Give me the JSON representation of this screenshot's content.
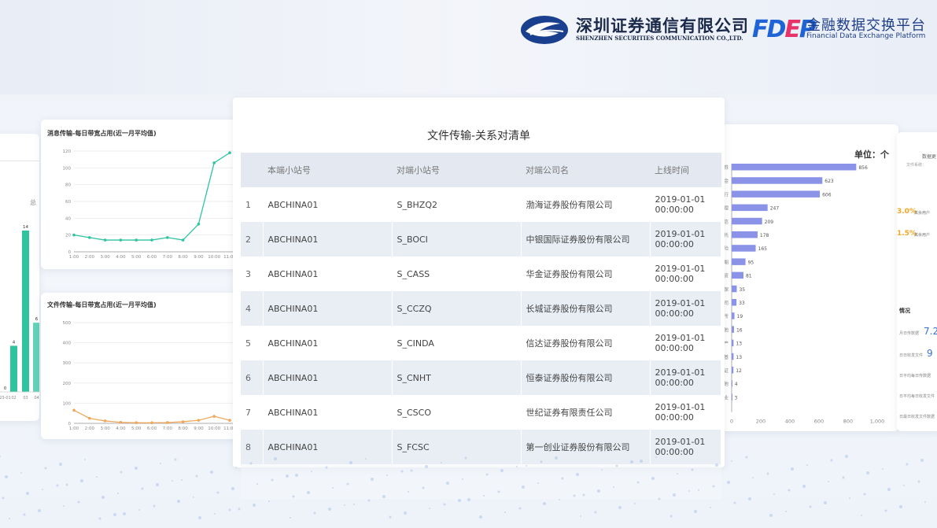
{
  "brand": {
    "company_cn": "深圳证券通信有限公司",
    "company_en": "SHENZHEN SECURITIES COMMUNICATION CO.,LTD.",
    "fdep": "FDEP",
    "platform_cn": "金融数据交换平台",
    "platform_en": "Financial Data Exchange Platform"
  },
  "colors": {
    "teal": "#2ec4a0",
    "orange": "#f0a75a",
    "bar_blue": "#8a93e8",
    "brand_blue": "#1e64d7",
    "brand_pink": "#e8336a"
  },
  "left_card": {
    "side_text": "总",
    "chart_data": {
      "type": "bar",
      "categories": [
        "23-01",
        "02",
        "03",
        "04"
      ],
      "values": [
        0,
        4,
        14,
        6
      ],
      "color": "#2ec4a0"
    }
  },
  "msg_chart": {
    "title": "消息传输-每日带宽占用(近一月平均值)",
    "chart_data": {
      "type": "line",
      "x": [
        "1:00",
        "2:00",
        "3:00",
        "4:00",
        "5:00",
        "6:00",
        "7:00",
        "8:00",
        "9:00",
        "10:00",
        "11:00"
      ],
      "values": [
        20,
        17,
        14,
        14,
        14,
        14,
        17,
        14,
        33,
        106,
        118
      ],
      "ylim": [
        0,
        120
      ],
      "yticks": [
        0,
        20,
        40,
        60,
        80,
        100,
        120
      ],
      "color": "#2ec4a0"
    }
  },
  "file_chart": {
    "title": "文件传输-每日带宽占用(近一月平均值)",
    "chart_data": {
      "type": "line",
      "x": [
        "1:00",
        "2:00",
        "3:00",
        "4:00",
        "5:00",
        "6:00",
        "7:00",
        "8:00",
        "9:00",
        "10:00",
        "11:00"
      ],
      "values": [
        65,
        25,
        12,
        5,
        3,
        3,
        4,
        8,
        15,
        35,
        15
      ],
      "ylim": [
        0,
        500
      ],
      "yticks": [
        0,
        100,
        200,
        300,
        400,
        500
      ],
      "color": "#f0a75a"
    }
  },
  "relation_table": {
    "title": "文件传输-关系对清单",
    "columns": [
      "",
      "本端小站号",
      "对端小站号",
      "对端公司名",
      "上线时间"
    ],
    "rows": [
      [
        "1",
        "ABCHINA01",
        "S_BHZQ2",
        "渤海证券股份有限公司",
        "2019-01-01 00:00:00"
      ],
      [
        "2",
        "ABCHINA01",
        "S_BOCI",
        "中银国际证券股份有限公司",
        "2019-01-01 00:00:00"
      ],
      [
        "3",
        "ABCHINA01",
        "S_CASS",
        "华金证券股份有限公司",
        "2019-01-01 00:00:00"
      ],
      [
        "4",
        "ABCHINA01",
        "S_CCZQ",
        "长城证券股份有限公司",
        "2019-01-01 00:00:00"
      ],
      [
        "5",
        "ABCHINA01",
        "S_CINDA",
        "信达证券股份有限公司",
        "2019-01-01 00:00:00"
      ],
      [
        "6",
        "ABCHINA01",
        "S_CNHT",
        "恒泰证券股份有限公司",
        "2019-01-01 00:00:00"
      ],
      [
        "7",
        "ABCHINA01",
        "S_CSCO",
        "世纪证券有限责任公司",
        "2019-01-01 00:00:00"
      ],
      [
        "8",
        "ABCHINA01",
        "S_FCSC",
        "第一创业证券股份有限公司",
        "2019-01-01 00:00:00"
      ]
    ]
  },
  "bar_chart": {
    "unit": "单位：个",
    "chart_data": {
      "type": "bar",
      "orientation": "horizontal",
      "categories": [
        "券",
        "金",
        "行",
        "理",
        "信",
        "托",
        "险",
        "期",
        "资",
        "保",
        "司",
        "所",
        "他",
        "产",
        "基",
        "证",
        "他",
        "业"
      ],
      "values": [
        856,
        623,
        606,
        247,
        209,
        178,
        165,
        95,
        81,
        35,
        33,
        19,
        16,
        13,
        13,
        12,
        4,
        3
      ],
      "xlim": [
        0,
        1000
      ],
      "xticks": [
        "0",
        "200",
        "400",
        "600",
        "800",
        "1,000"
      ],
      "color": "#8a93e8"
    }
  },
  "right_card": {
    "header": "数据更",
    "sub": "文件系统：",
    "pct1": "3.0%",
    "pct1_label": "其余用户",
    "pct2": "1.5%",
    "pct2_label": "其余用户",
    "section": "情况",
    "stats": [
      {
        "label": "月日传数据",
        "value": "7.2"
      },
      {
        "label": "日日收发文件",
        "value": "9"
      },
      {
        "label": "日平均每日传数据",
        "value": ""
      },
      {
        "label": "日平均每日收发文件",
        "value": ""
      },
      {
        "label": "日最日收发文件数据",
        "value": ""
      }
    ]
  }
}
